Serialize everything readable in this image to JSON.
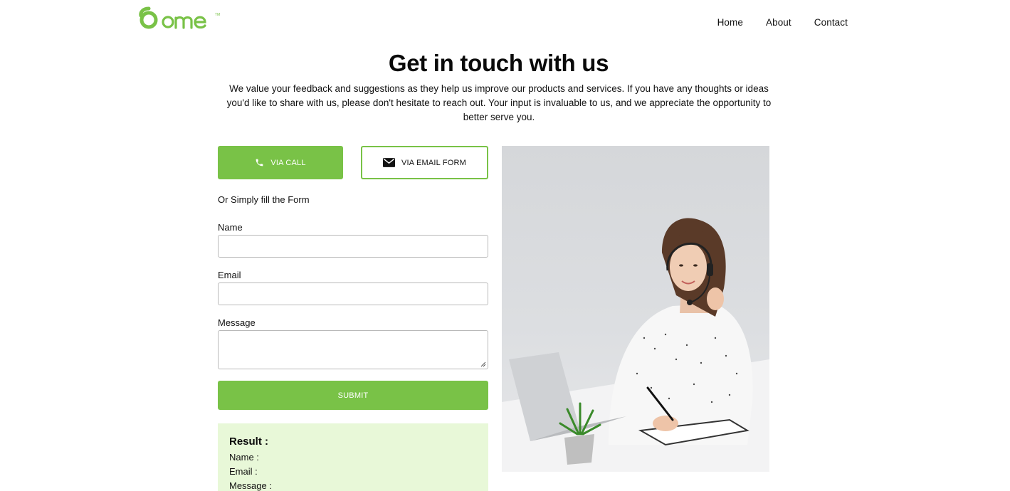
{
  "brand": {
    "name": "dome",
    "trademark": "TM",
    "color": "#79c247"
  },
  "nav": [
    {
      "label": "Home"
    },
    {
      "label": "About"
    },
    {
      "label": "Contact"
    }
  ],
  "hero": {
    "title": "Get in touch with us",
    "intro": "We value your feedback and suggestions as they help us improve our products and services. If you have any thoughts or ideas you'd like to share with us, please don't hesitate to reach out. Your input is invaluable to us, and we appreciate the opportunity to better serve you."
  },
  "options": {
    "call": {
      "label": "VIA CALL",
      "icon": "phone-icon"
    },
    "email": {
      "label": "VIA EMAIL FORM",
      "icon": "envelope-icon"
    }
  },
  "form": {
    "hint": "Or Simply fill the Form",
    "name_label": "Name",
    "name_value": "",
    "email_label": "Email",
    "email_value": "",
    "message_label": "Message",
    "message_value": "",
    "submit_label": "SUBMIT"
  },
  "result": {
    "heading": "Result :",
    "name_label": "Name :",
    "email_label": "Email :",
    "message_label": "Message :"
  },
  "colors": {
    "accent": "#79c247",
    "result_bg": "#e8f8d8",
    "field_border": "#b9b9b9"
  },
  "image": {
    "subject": "customer-support-agent-with-headset"
  }
}
